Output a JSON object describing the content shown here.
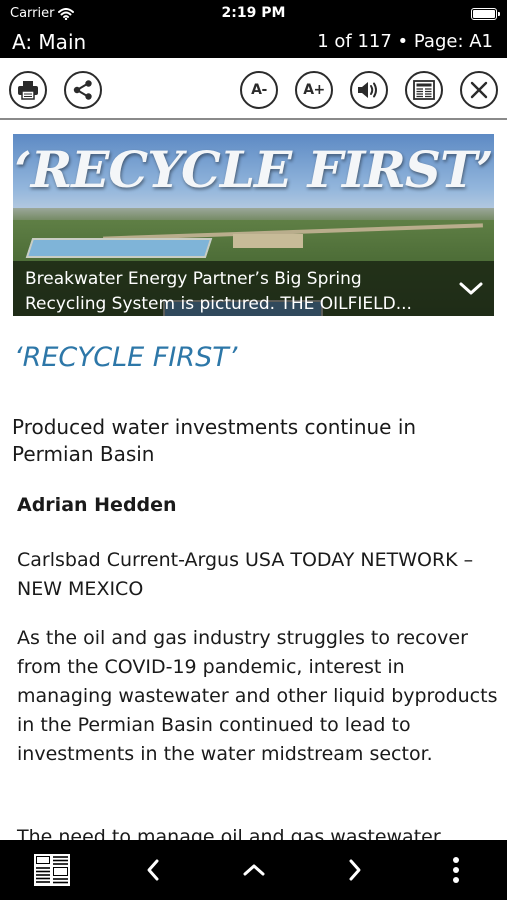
{
  "status_bar": {
    "carrier": "Carrier",
    "time": "2:19 PM"
  },
  "title_bar": {
    "section": "A: Main",
    "pager": "1 of 117 • Page: A1"
  },
  "toolbar": {
    "decrease_font_label": "A-",
    "increase_font_label": "A+"
  },
  "hero": {
    "headline": "‘RECYCLE FIRST’",
    "caption": "Breakwater Energy Partner’s Big Spring Recycling System is pictured. THE OILFIELD..."
  },
  "article": {
    "title": "‘RECYCLE FIRST’",
    "subhead": "Produced water investments continue in Permian Basin",
    "byline": "Adrian Hedden",
    "source": "Carlsbad Current-Argus USA TODAY NETWORK – NEW MEXICO",
    "paragraphs": [
      "As the oil and gas industry struggles to recover from the COVID-19 pandemic, interest in managing wastewater and other liquid byproducts in the Permian Basin continued to lead to investments in the water midstream sector.",
      "The need to manage oil and gas wastewater"
    ]
  },
  "colors": {
    "accent_title": "#2d77a8",
    "bar_background": "#000000",
    "icon_stroke": "#2b2b2b"
  },
  "icons": {
    "toolbar": [
      "print-icon",
      "share-icon",
      "decrease-font-icon",
      "increase-font-icon",
      "speaker-icon",
      "newspaper-view-icon",
      "close-icon"
    ],
    "bottom_bar": [
      "page-thumbnails-icon",
      "chevron-left-icon",
      "chevron-up-icon",
      "chevron-right-icon",
      "more-vertical-icon"
    ]
  }
}
